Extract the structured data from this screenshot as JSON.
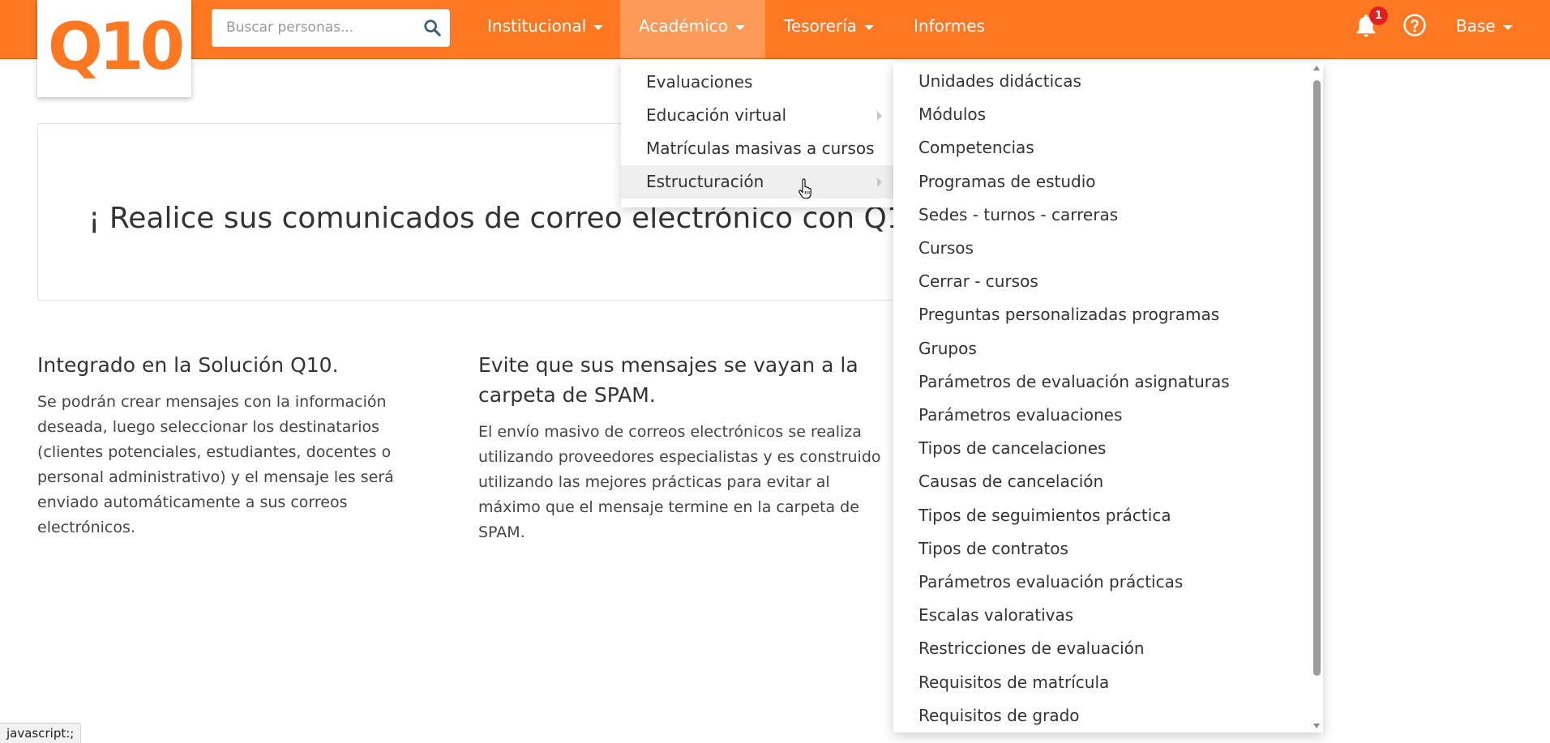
{
  "brand": {
    "logo_text": "Q10",
    "color": "#fd7820"
  },
  "search": {
    "placeholder": "Buscar personas...",
    "value": "",
    "icon": "search-icon"
  },
  "nav": {
    "items": [
      {
        "label": "Institucional",
        "has_caret": true
      },
      {
        "label": "Académico",
        "has_caret": true,
        "active": true
      },
      {
        "label": "Tesorería",
        "has_caret": true
      },
      {
        "label": "Informes",
        "has_caret": false
      }
    ],
    "notifications_count": "1",
    "user_label": "Base"
  },
  "academic_menu": {
    "items": [
      {
        "label": "Evaluaciones"
      },
      {
        "label": "Educación virtual",
        "submenu": true
      },
      {
        "label": "Matrículas masivas a cursos"
      },
      {
        "label": "Estructuración",
        "submenu": true,
        "hovered": true
      }
    ]
  },
  "structure_submenu": {
    "items": [
      "Unidades didácticas",
      "Módulos",
      "Competencias",
      "Programas de estudio",
      "Sedes - turnos - carreras",
      "Cursos",
      "Cerrar - cursos",
      "Preguntas personalizadas programas",
      "Grupos",
      "Parámetros de evaluación asignaturas",
      "Parámetros evaluaciones",
      "Tipos de cancelaciones",
      "Causas de cancelación",
      "Tipos de seguimientos práctica",
      "Tipos de contratos",
      "Parámetros evaluación prácticas",
      "Escalas valorativas",
      "Restricciones de evaluación",
      "Requisitos de matrícula",
      "Requisitos de grado"
    ]
  },
  "banner": {
    "text": "¡ Realice sus comunicados de correo electrónico con Q10 !"
  },
  "features": [
    {
      "title": "Integrado en la Solución Q10.",
      "body": "Se podrán crear mensajes con la información deseada, luego seleccionar los destinatarios (clientes potenciales, estudiantes, docentes o personal administrativo) y el mensaje les será enviado automáticamente a sus correos electrónicos."
    },
    {
      "title": "Evite que sus mensajes se vayan a la carpeta de SPAM.",
      "body": "El envío masivo de correos electrónicos se realiza utilizando proveedores especialistas y es construido utilizando las mejores prácticas para evitar al máximo que el mensaje termine en la carpeta de SPAM."
    }
  ],
  "statusbar": {
    "text": "javascript:;"
  }
}
